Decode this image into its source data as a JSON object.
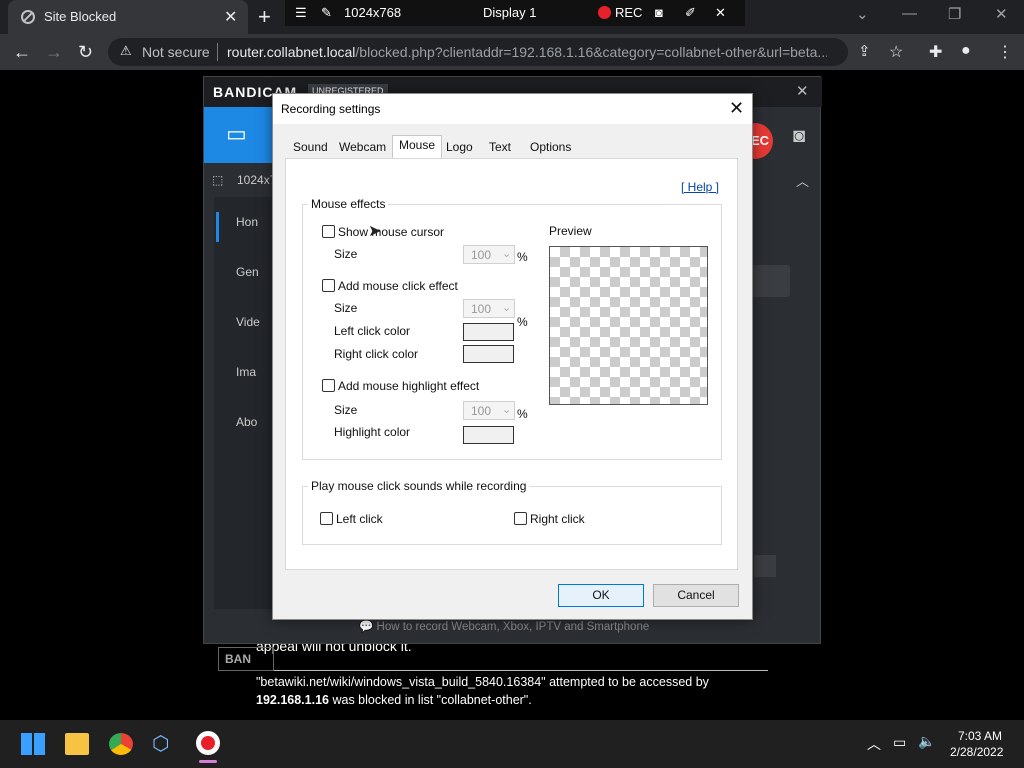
{
  "browser": {
    "tab_title": "Site Blocked",
    "tab_close": "✕",
    "new_tab": "+",
    "not_secure": "Not secure",
    "url_host": "router.collabnet.local",
    "url_rest": "/blocked.php?clientaddr=192.168.1.16&category=collabnet-other&url=beta..."
  },
  "bandibar": {
    "resolution": "1024x768",
    "display": "Display 1",
    "rec": "REC"
  },
  "bandicam": {
    "logo": "BANDICAM",
    "badge": "UNREGISTERED",
    "resolution": "1024x7",
    "side": [
      "Hon",
      "Gen",
      "Vide",
      "Ima",
      "Abo"
    ],
    "footer_label": "BAN",
    "hint": "How to record Webcam, Xbox, IPTV and Smartphone"
  },
  "page": {
    "line1": "appeal will not unblock it.",
    "line2": "\"betawiki.net/wiki/windows_vista_build_5840.16384\" attempted to be accessed by",
    "line3_ip": "192.168.1.16",
    "line3_rest": " was blocked in list \"collabnet-other\"."
  },
  "dialog": {
    "title": "Recording settings",
    "close": "✕",
    "tabs": [
      "Sound",
      "Webcam",
      "Mouse",
      "Logo",
      "Text",
      "Options"
    ],
    "active_tab": "Mouse",
    "help": "[ Help ]",
    "mouse_effects": {
      "legend": "Mouse effects",
      "show_cursor": "Show mouse cursor",
      "size_label": "Size",
      "size_value": "100",
      "percent": "%",
      "click_effect": "Add mouse click effect",
      "left_color": "Left click color",
      "right_color": "Right click color",
      "highlight_effect": "Add mouse highlight effect",
      "highlight_color": "Highlight color",
      "preview": "Preview"
    },
    "sounds": {
      "legend": "Play mouse click sounds while recording",
      "left": "Left click",
      "right": "Right click"
    },
    "ok": "OK",
    "cancel": "Cancel"
  },
  "taskbar": {
    "time": "7:03 AM",
    "date": "2/28/2022"
  }
}
